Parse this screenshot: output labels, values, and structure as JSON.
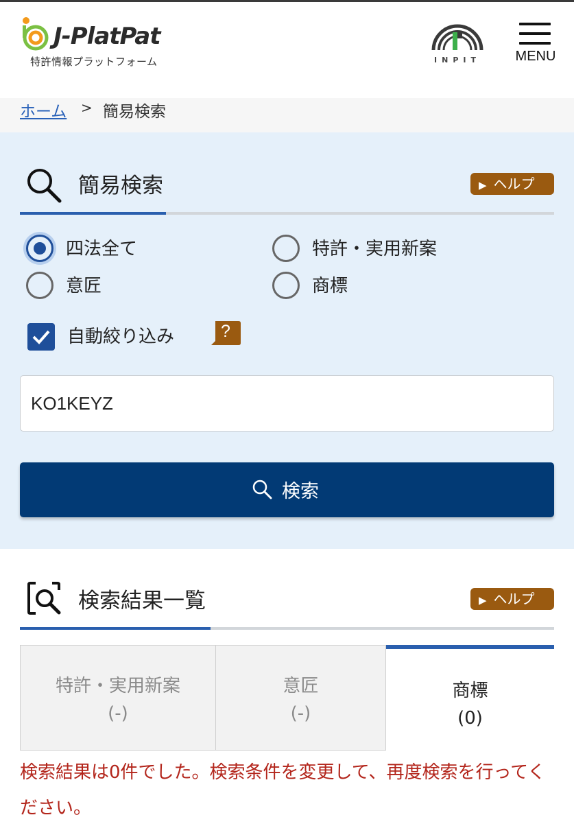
{
  "header": {
    "logo_title": "J-PlatPat",
    "logo_subtitle": "特許情報プラットフォーム",
    "inpit_label": "INPIT",
    "menu_label": "MENU"
  },
  "breadcrumb": {
    "home": "ホーム",
    "separator": ">",
    "current": "簡易検索"
  },
  "search": {
    "title": "簡易検索",
    "help_label": "ヘルプ",
    "radios": [
      {
        "label": "四法全て",
        "checked": true
      },
      {
        "label": "特許・実用新案",
        "checked": false
      },
      {
        "label": "意匠",
        "checked": false
      },
      {
        "label": "商標",
        "checked": false
      }
    ],
    "auto_filter_label": "自動絞り込み",
    "auto_filter_checked": true,
    "question_mark": "?",
    "input_value": "KO1KEYZ",
    "button_label": "検索"
  },
  "results": {
    "title": "検索結果一覧",
    "help_label": "ヘルプ",
    "tabs": [
      {
        "name": "特許・実用新案",
        "count": "(-)"
      },
      {
        "name": "意匠",
        "count": "(-)"
      },
      {
        "name": "商標",
        "count": "(0)"
      }
    ],
    "active_tab": 2,
    "message": "検索結果は0件でした。検索条件を変更して、再度検索を行ってください。"
  },
  "colors": {
    "accent_blue": "#2a5fae",
    "button_navy": "#023a75",
    "help_brown": "#9a5a10",
    "error_red": "#b3251b",
    "panel_bg": "#e5f0fa"
  }
}
